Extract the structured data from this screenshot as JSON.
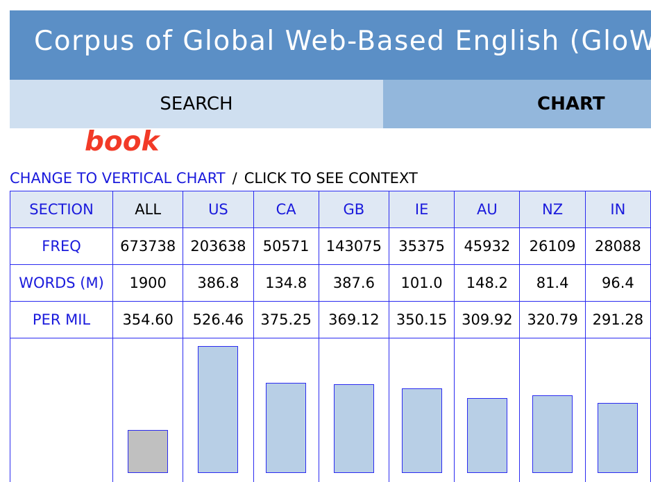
{
  "header": {
    "title": "Corpus of Global Web-Based English (GloWbE)"
  },
  "tabs": [
    {
      "label": "SEARCH"
    },
    {
      "label": "CHART"
    }
  ],
  "query": {
    "word": "book"
  },
  "links": {
    "vertical_chart": "CHANGE TO VERTICAL CHART",
    "separator": "/",
    "context_hint": "CLICK TO SEE CONTEXT"
  },
  "row_labels": {
    "section": "SECTION",
    "freq": "FREQ",
    "words": "WORDS (M)",
    "per_mil": "PER MIL"
  },
  "sections": [
    {
      "name": "ALL",
      "freq": "673738",
      "words": "1900",
      "per_mil": "354.60"
    },
    {
      "name": "US",
      "freq": "203638",
      "words": "386.8",
      "per_mil": "526.46"
    },
    {
      "name": "CA",
      "freq": "50571",
      "words": "134.8",
      "per_mil": "375.25"
    },
    {
      "name": "GB",
      "freq": "143075",
      "words": "387.6",
      "per_mil": "369.12"
    },
    {
      "name": "IE",
      "freq": "35375",
      "words": "101.0",
      "per_mil": "350.15"
    },
    {
      "name": "AU",
      "freq": "45932",
      "words": "148.2",
      "per_mil": "309.92"
    },
    {
      "name": "NZ",
      "freq": "26109",
      "words": "81.4",
      "per_mil": "320.79"
    },
    {
      "name": "IN",
      "freq": "28088",
      "words": "96.4",
      "per_mil": "291.28"
    }
  ],
  "colors": {
    "header_bg": "#5b8fc6",
    "tab_search_bg": "#cfdff0",
    "tab_chart_bg": "#93b7dc",
    "query_word": "#f23a27",
    "link": "#1a1adc",
    "bar_fill": "#b8cfe6",
    "bar_all_fill": "#c0c0c0"
  }
}
